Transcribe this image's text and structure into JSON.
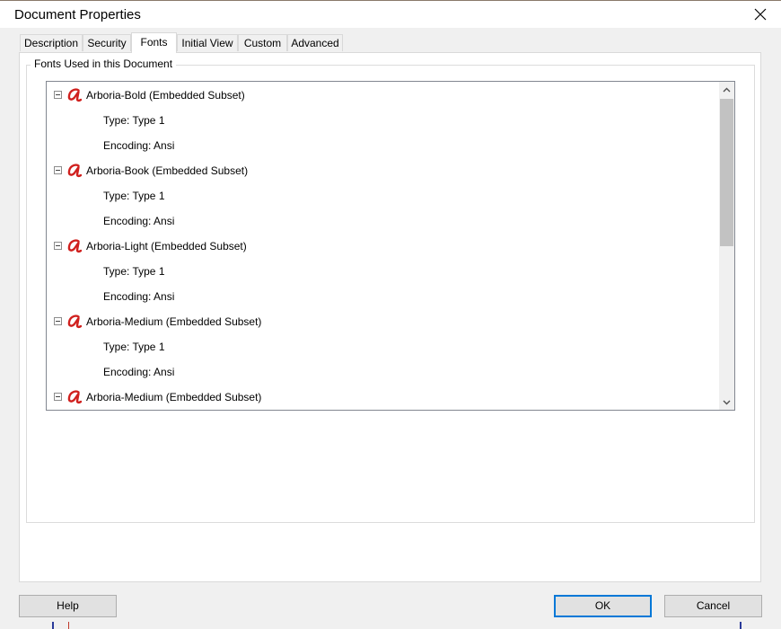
{
  "window": {
    "title": "Document Properties"
  },
  "tabs": [
    {
      "label": "Description",
      "active": false
    },
    {
      "label": "Security",
      "active": false
    },
    {
      "label": "Fonts",
      "active": true
    },
    {
      "label": "Initial View",
      "active": false
    },
    {
      "label": "Custom",
      "active": false
    },
    {
      "label": "Advanced",
      "active": false
    }
  ],
  "fonts_group": {
    "label": "Fonts Used in this Document",
    "fonts": [
      {
        "name": "Arboria-Bold (Embedded Subset)",
        "type": "Type: Type 1",
        "encoding": "Encoding: Ansi"
      },
      {
        "name": "Arboria-Book (Embedded Subset)",
        "type": "Type: Type 1",
        "encoding": "Encoding: Ansi"
      },
      {
        "name": "Arboria-Light (Embedded Subset)",
        "type": "Type: Type 1",
        "encoding": "Encoding: Ansi"
      },
      {
        "name": "Arboria-Medium (Embedded Subset)",
        "type": "Type: Type 1",
        "encoding": "Encoding: Ansi"
      },
      {
        "name": "Arboria-Medium (Embedded Subset)",
        "type": "",
        "encoding": ""
      }
    ]
  },
  "buttons": {
    "help": "Help",
    "ok": "OK",
    "cancel": "Cancel"
  },
  "icons": {
    "font": "acrobat-font-icon",
    "close": "close-icon",
    "expander": "collapse-icon"
  },
  "colors": {
    "accent": "#0078d7",
    "font_icon": "#d0201e"
  }
}
